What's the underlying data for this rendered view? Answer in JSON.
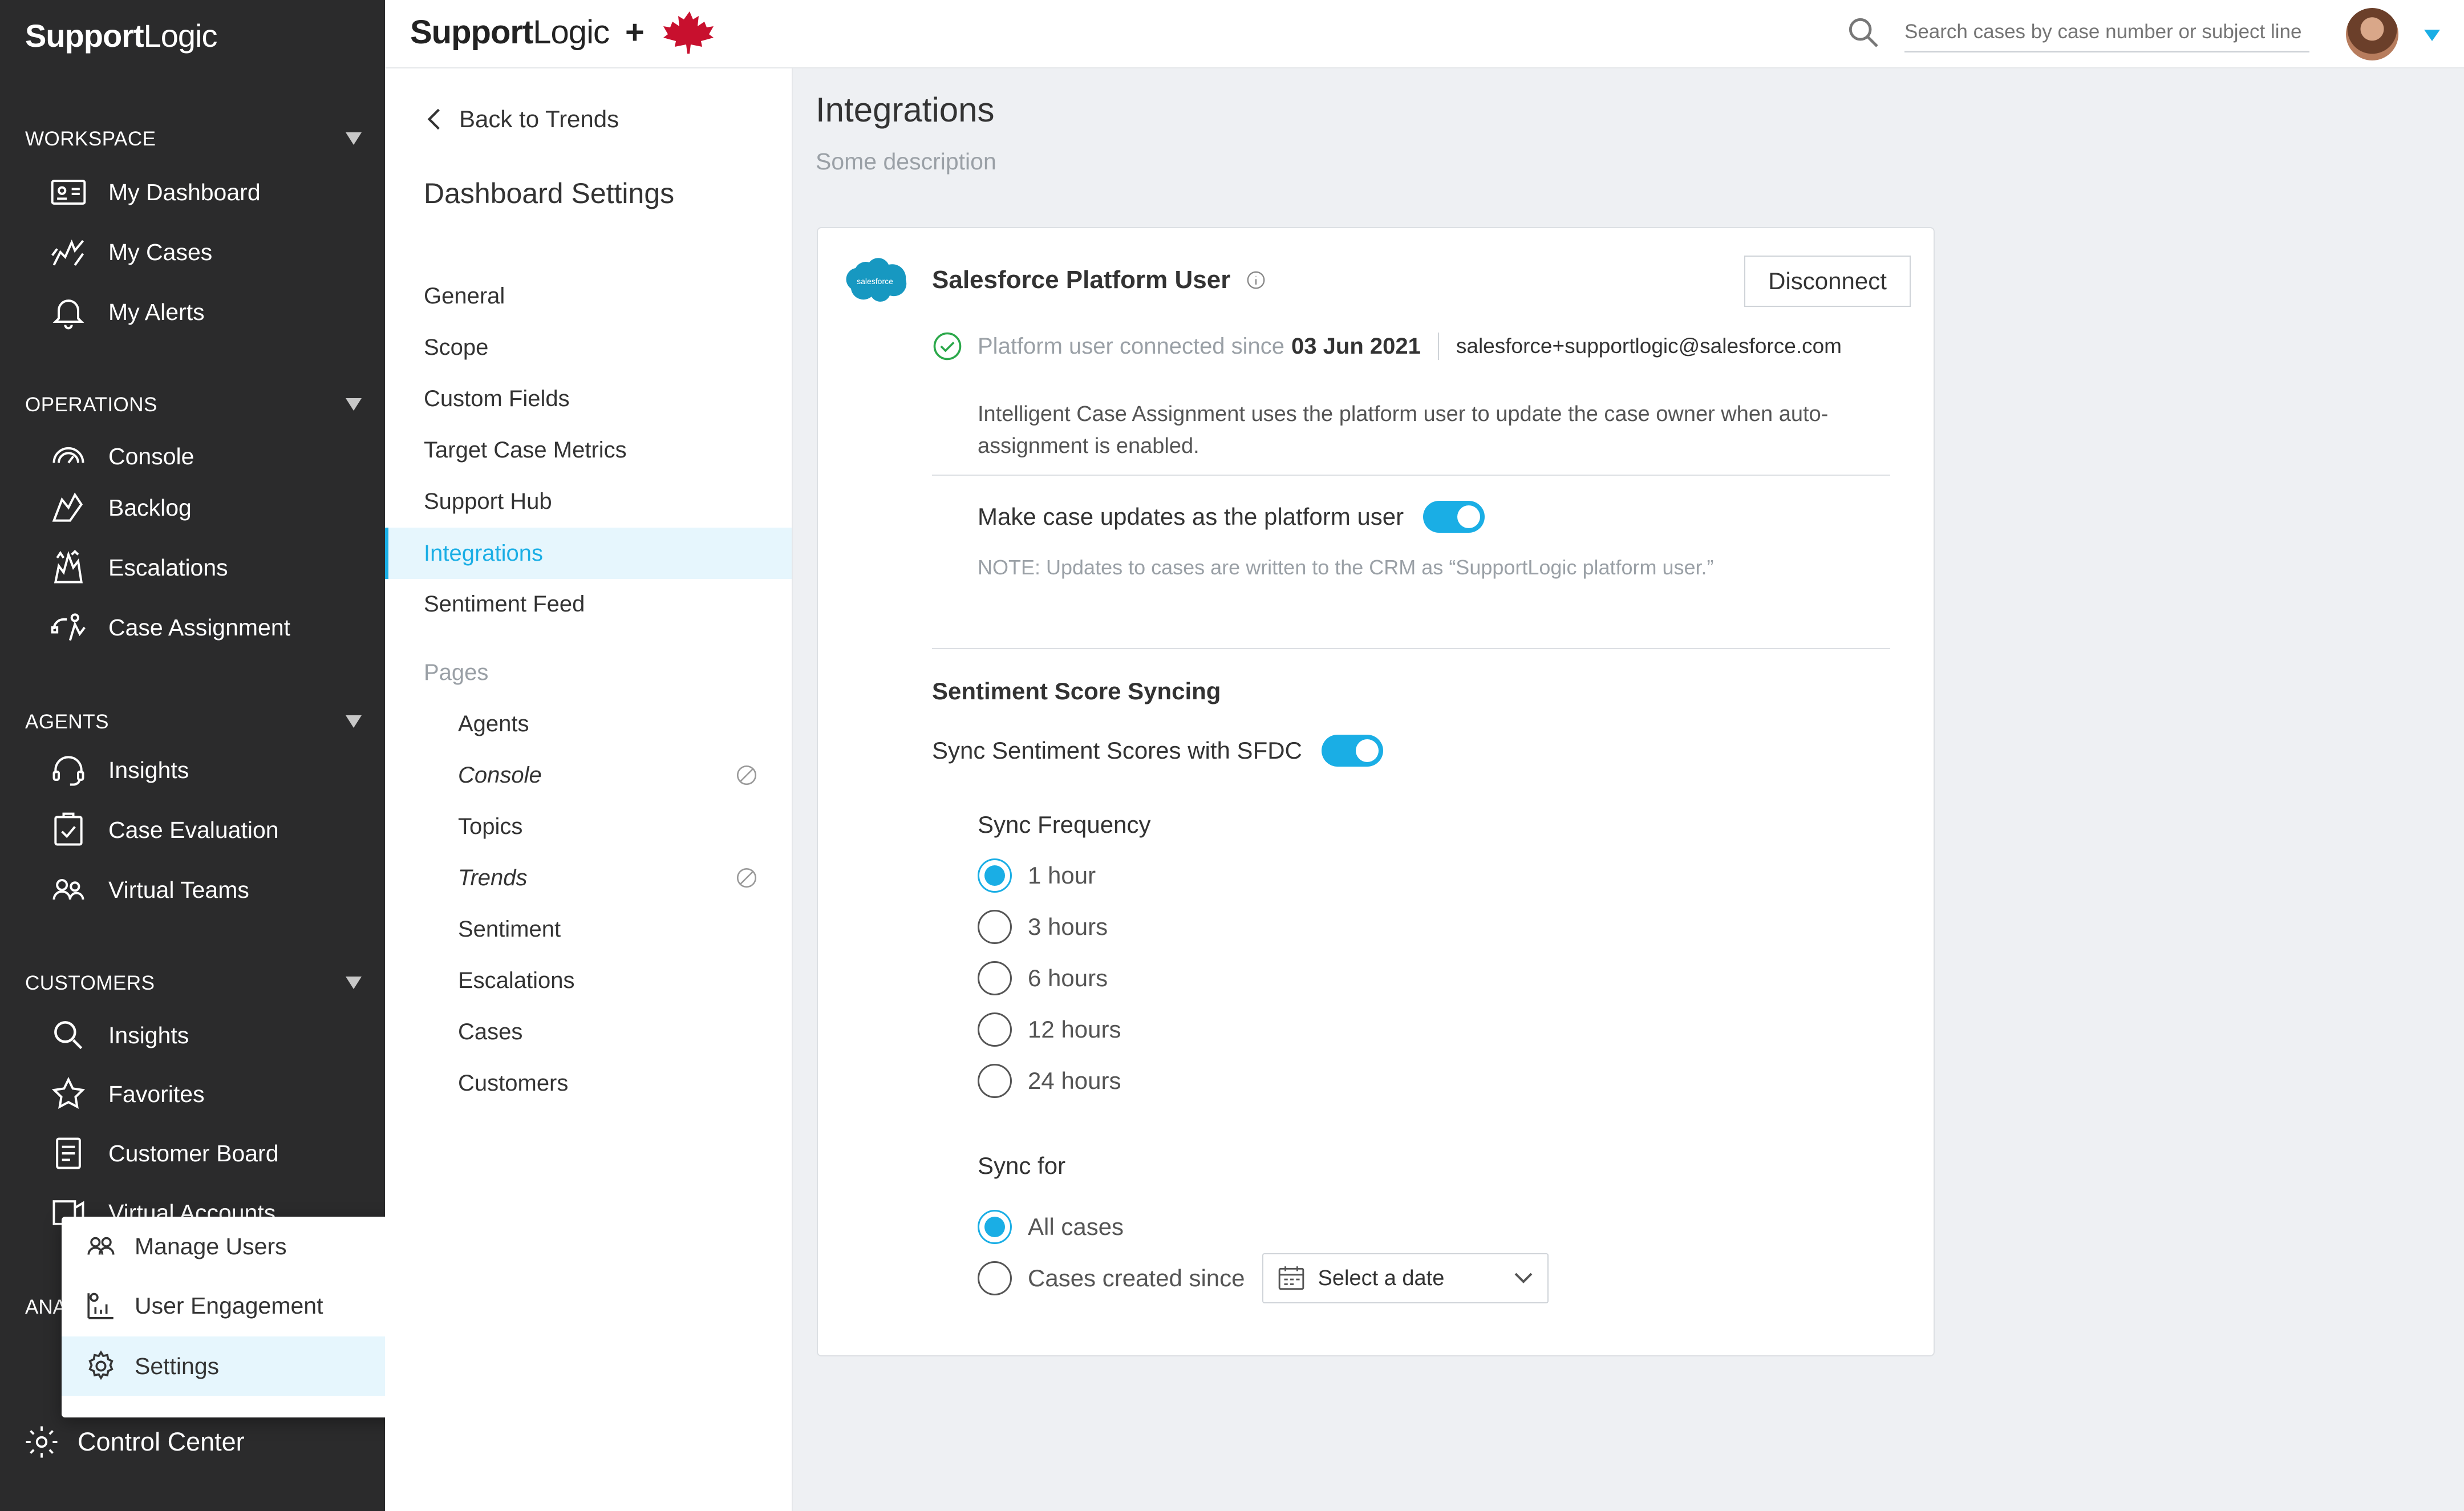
{
  "sidebar": {
    "logo_bold": "Support",
    "logo_light": "Logic",
    "sections": {
      "workspace": "WORKSPACE",
      "operations": "OPERATIONS",
      "agents": "AGENTS",
      "customers": "CUSTOMERS",
      "analytics_partial": "ANA"
    },
    "workspace_items": [
      "My Dashboard",
      "My Cases",
      "My Alerts"
    ],
    "operations_items": [
      "Console",
      "Backlog",
      "Escalations",
      "Case Assignment"
    ],
    "agents_items": [
      "Insights",
      "Case Evaluation",
      "Virtual Teams"
    ],
    "customers_items": [
      "Insights",
      "Favorites",
      "Customer Board",
      "Virtual Accounts"
    ],
    "control_center": "Control Center"
  },
  "popup": {
    "items": [
      "Manage Users",
      "User Engagement",
      "Settings"
    ],
    "active": "Settings"
  },
  "topbar": {
    "brand_bold": "Support",
    "brand_light": "Logic",
    "plus": "+",
    "search_placeholder": "Search cases by case number or subject line"
  },
  "settings_nav": {
    "back_label": "Back to Trends",
    "title": "Dashboard Settings",
    "items": [
      "General",
      "Scope",
      "Custom Fields",
      "Target Case Metrics",
      "Support Hub",
      "Integrations",
      "Sentiment Feed"
    ],
    "active": "Integrations",
    "pages_label": "Pages",
    "pages": [
      "Agents",
      "Console",
      "Topics",
      "Trends",
      "Sentiment",
      "Escalations",
      "Cases",
      "Customers"
    ]
  },
  "main": {
    "title": "Integrations",
    "description": "Some description",
    "card": {
      "title": "Salesforce Platform User",
      "logo_text": "salesforce",
      "disconnect_label": "Disconnect",
      "status_prefix": "Platform user connected since",
      "status_date": "03 Jun 2021",
      "email": "salesforce+supportlogic@salesforce.com",
      "assignment_text": "Intelligent Case Assignment uses the platform user to update the case owner when auto-assignment is enabled.",
      "platform_toggle_label": "Make case updates as the platform user",
      "platform_toggle_on": true,
      "note": "NOTE: Updates to cases are written to the CRM as “SupportLogic platform user.”",
      "sentiment_title": "Sentiment Score Syncing",
      "sync_toggle_label": "Sync Sentiment Scores with SFDC",
      "sync_toggle_on": true,
      "frequency_label": "Sync Frequency",
      "frequency_options": [
        "1 hour",
        "3 hours",
        "6 hours",
        "12 hours",
        "24 hours"
      ],
      "frequency_selected": "1 hour",
      "sync_for_label": "Sync for",
      "sync_for_options": [
        "All cases",
        "Cases created since"
      ],
      "sync_for_selected": "All cases",
      "date_placeholder": "Select a date"
    }
  },
  "colors": {
    "accent": "#1aaee5",
    "sidebar_bg": "#2b2b2c",
    "active_bg": "#e6f6fd",
    "success": "#2ba84a",
    "salesforce": "#1798c1"
  }
}
